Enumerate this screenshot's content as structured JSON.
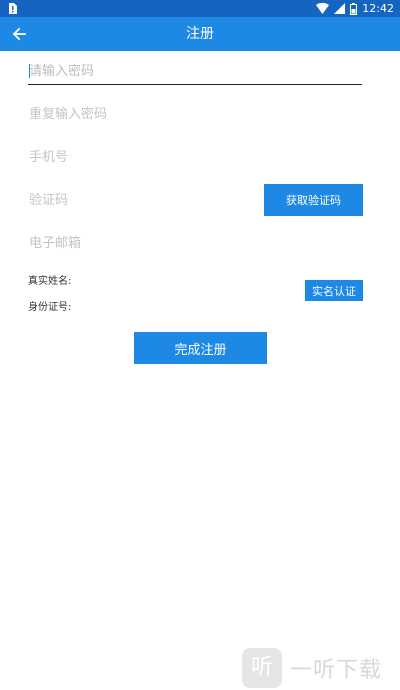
{
  "statusbar": {
    "time": "12:42",
    "icons": [
      "sim-alert-icon",
      "wifi-icon",
      "signal-icon",
      "battery-icon"
    ]
  },
  "appbar": {
    "title": "注册",
    "back_icon": "arrow-left-icon"
  },
  "form": {
    "password_placeholder": "请输入密码",
    "repeat_placeholder": "重复输入密码",
    "phone_placeholder": "手机号",
    "code_placeholder": "验证码",
    "email_placeholder": "电子邮箱",
    "get_code_label": "获取验证码",
    "real_name_label": "真实姓名:",
    "id_number_label": "身份证号:",
    "verify_label": "实名认证",
    "submit_label": "完成注册"
  },
  "watermark": {
    "logo_char": "听",
    "text": "一听下载"
  },
  "colors": {
    "statusbar": "#1565c0",
    "primary": "#1e88e5",
    "placeholder": "#c4c4c4"
  }
}
